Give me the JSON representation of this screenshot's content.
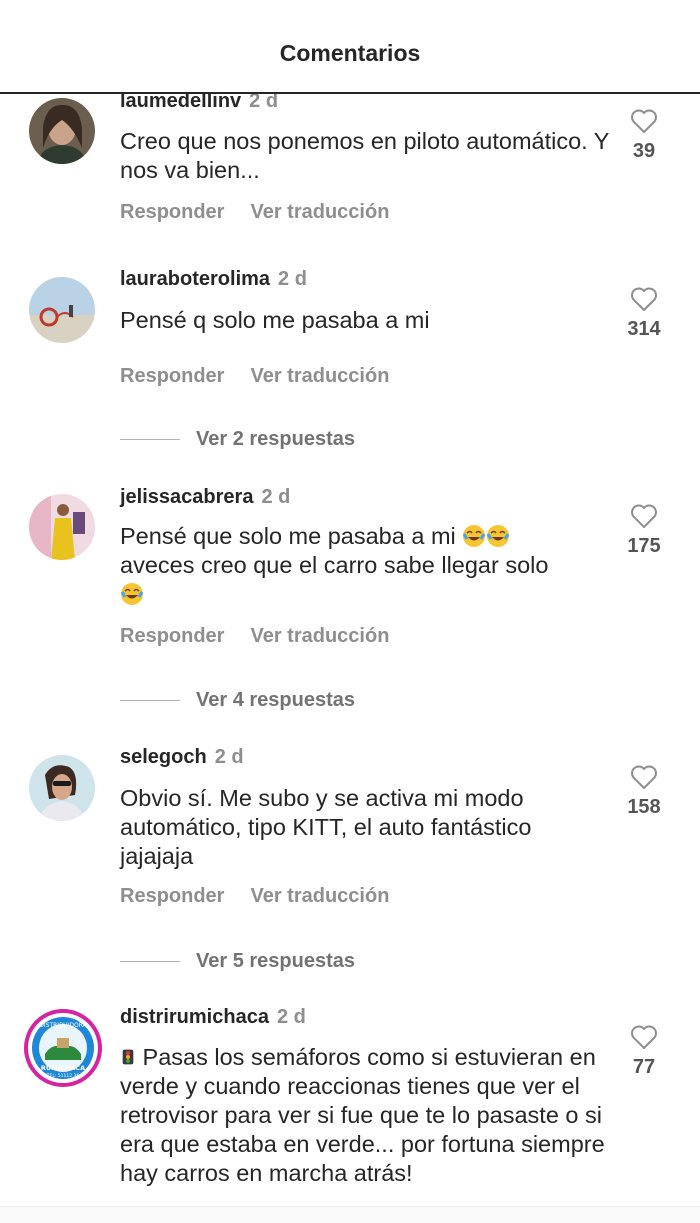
{
  "header": {
    "title": "Comentarios"
  },
  "actions": {
    "reply": "Responder",
    "translate": "Ver traducción"
  },
  "comments": [
    {
      "username": "laumedellinv",
      "time": "2 d",
      "text": "Creo que nos ponemos en piloto automático. Y nos va bien...",
      "likes": "39"
    },
    {
      "username": "lauraboterolima",
      "time": "2 d",
      "text": "Pensé q solo me pasaba a mi",
      "likes": "314",
      "replies": "Ver 2 respuestas"
    },
    {
      "username": "jelissacabrera",
      "time": "2 d",
      "text_line1": "Pensé que solo me pasaba a mi",
      "text_line2": "aveces creo que el carro sabe llegar solo",
      "likes": "175",
      "replies": "Ver 4 respuestas"
    },
    {
      "username": "selegoch",
      "time": "2 d",
      "text": "Obvio sí. Me subo y se activa mi modo automático, tipo KITT, el auto fantástico jajajaja",
      "likes": "158",
      "replies": "Ver 5 respuestas"
    },
    {
      "username": "distrirumichaca",
      "time": "2 d",
      "text": "Pasas los semáforos como si estuvieran en verde y cuando reaccionas tienes que ver el retrovisor para ver si fue que te lo pasaste o si era que estaba en verde... por fortuna siempre hay carros en marcha atrás!",
      "likes": "77"
    }
  ],
  "avatars": {
    "distri_logo_top": "DISTRIBUIDORA",
    "distri_logo_bottom": "RUMICHACA",
    "distri_logo_tel": "TEL: 51112 36"
  },
  "icons": {
    "like": "heart-outline-icon",
    "laugh": "face-with-tears-of-joy-emoji",
    "traffic_light": "traffic-light-emoji"
  },
  "colors": {
    "text": "#262626",
    "muted": "#8e8e8e",
    "accent_ring": "#d6249f"
  }
}
